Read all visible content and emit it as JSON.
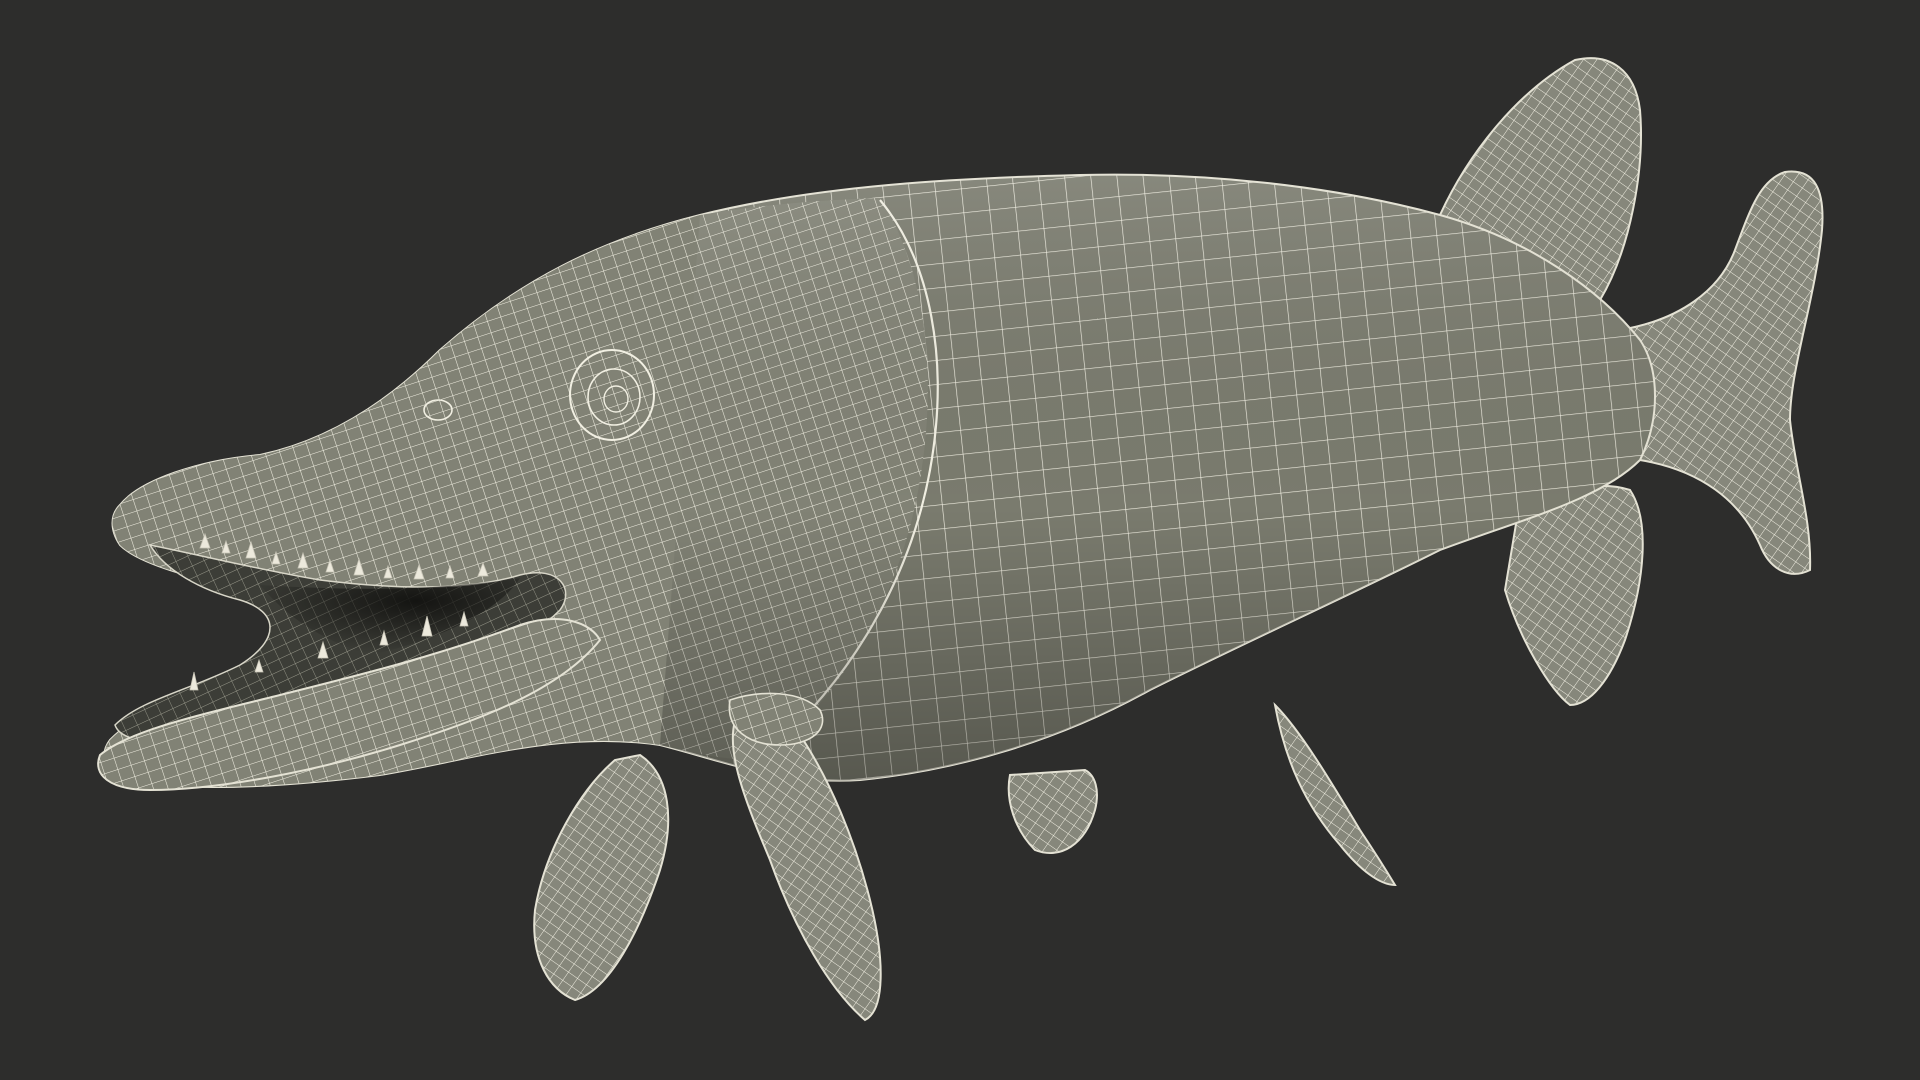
{
  "scene": {
    "subject": "pike-fish-wireframe",
    "colors": {
      "background": "#2d2d2c",
      "surface": "#7a7b6e",
      "surface_shadow": "#5d5e53",
      "fin": "#85867a",
      "mouth_interior": "#3c3d37",
      "mouth_shadow": "#1e1f1c",
      "wire": "#f1efe2",
      "outline": "#e4e2d4"
    }
  }
}
